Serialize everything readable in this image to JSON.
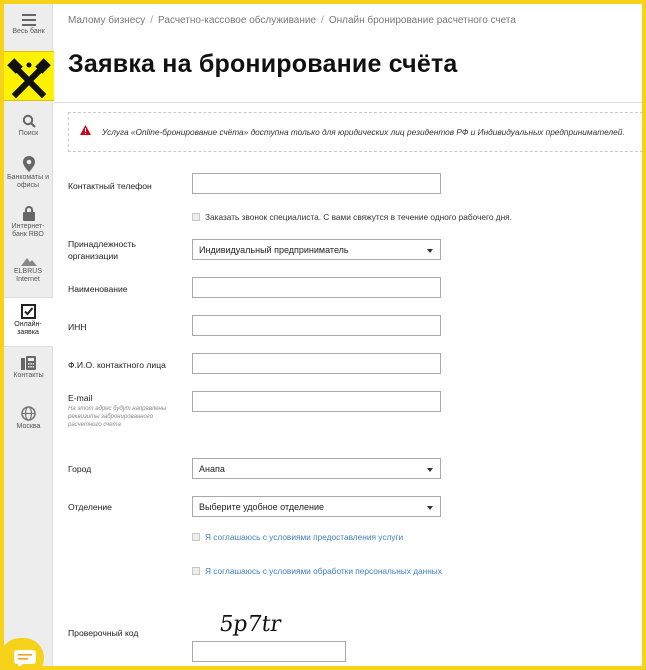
{
  "sidebar": {
    "all_label": "Весь банк",
    "items": [
      {
        "label": "Поиск",
        "icon": "search-icon"
      },
      {
        "label": "Банкоматы и офисы",
        "icon": "map-pin-icon"
      },
      {
        "label": "Интернет-банк RBO",
        "icon": "lock-icon"
      },
      {
        "label": "ELBRUS Internet",
        "icon": "mountain-icon"
      },
      {
        "label": "Онлайн-заявка",
        "icon": "checkbox-icon",
        "active": true
      },
      {
        "label": "Контакты",
        "icon": "phone-icon"
      },
      {
        "label": "Москва",
        "icon": "globe-icon"
      }
    ]
  },
  "breadcrumb": [
    "Малому бизнесу",
    "Расчетно-кассовое обслуживание",
    "Онлайн бронирование расчетного счета"
  ],
  "title": "Заявка на бронирование счёта",
  "alert": "Услуга «Online-бронирование счёта» доступна только для юридических лиц резидентов РФ и Индивидуальных предпринимателей.",
  "form": {
    "phone_label": "Контактный телефон",
    "phone_value": "",
    "callback_label": "Заказать звонок специалиста. С вами свяжутся в течение одного рабочего дня.",
    "org_label": "Принадлежность организации",
    "org_value": "Индивидуальный предприниматель",
    "name_label": "Наименование",
    "name_value": "",
    "inn_label": "ИНН",
    "inn_value": "",
    "contact_label": "Ф.И.О. контактного лица",
    "contact_value": "",
    "email_label": "E-mail",
    "email_hint": "На этот адрес будут направлены реквизиты забронированного расчетного счета",
    "email_value": "",
    "city_label": "Город",
    "city_value": "Анапа",
    "branch_label": "Отделение",
    "branch_value": "Выберите удобное отделение",
    "agree_service": "Я соглашаюсь с условиями предоставления услуги",
    "agree_data": "Я соглашаюсь с условиями обработки персональных данных",
    "captcha_label": "Проверочный код",
    "captcha_text": "5p7tr",
    "captcha_value": ""
  },
  "colors": {
    "brand_yellow": "#fff200",
    "frame": "#f7d21a",
    "alert_red": "#d0021b",
    "link": "#3f7fbf"
  }
}
